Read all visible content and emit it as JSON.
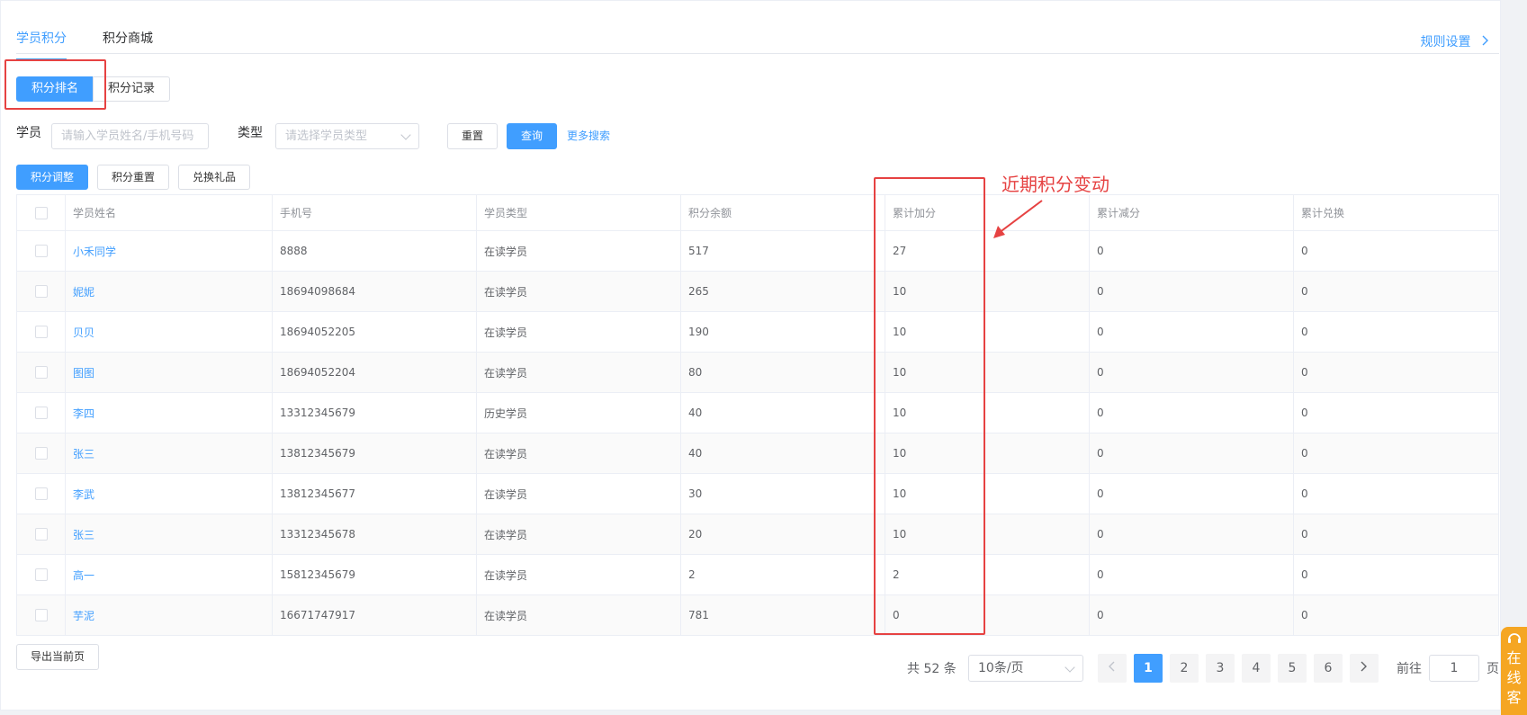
{
  "tabs": [
    {
      "label": "学员积分",
      "active": true
    },
    {
      "label": "积分商城",
      "active": false
    }
  ],
  "rule_link": "规则设置",
  "segments": [
    {
      "label": "积分排名",
      "active": true
    },
    {
      "label": "积分记录",
      "active": false
    }
  ],
  "search": {
    "student_label": "学员",
    "student_placeholder": "请输入学员姓名/手机号码",
    "type_label": "类型",
    "type_placeholder": "请选择学员类型",
    "reset_label": "重置",
    "query_label": "查询",
    "more_label": "更多搜索"
  },
  "actions": {
    "adjust_label": "积分调整",
    "reset_label": "积分重置",
    "redeem_label": "兑换礼品"
  },
  "table": {
    "columns": [
      "学员姓名",
      "手机号",
      "学员类型",
      "积分余额",
      "累计加分",
      "累计减分",
      "累计兑换"
    ],
    "rows": [
      {
        "name": "小禾同学",
        "phone": "8888",
        "type": "在读学员",
        "balance": "517",
        "added": "27",
        "deducted": "0",
        "redeemed": "0"
      },
      {
        "name": "妮妮",
        "phone": "18694098684",
        "type": "在读学员",
        "balance": "265",
        "added": "10",
        "deducted": "0",
        "redeemed": "0"
      },
      {
        "name": "贝贝",
        "phone": "18694052205",
        "type": "在读学员",
        "balance": "190",
        "added": "10",
        "deducted": "0",
        "redeemed": "0"
      },
      {
        "name": "图图",
        "phone": "18694052204",
        "type": "在读学员",
        "balance": "80",
        "added": "10",
        "deducted": "0",
        "redeemed": "0"
      },
      {
        "name": "李四",
        "phone": "13312345679",
        "type": "历史学员",
        "balance": "40",
        "added": "10",
        "deducted": "0",
        "redeemed": "0"
      },
      {
        "name": "张三",
        "phone": "13812345679",
        "type": "在读学员",
        "balance": "40",
        "added": "10",
        "deducted": "0",
        "redeemed": "0"
      },
      {
        "name": "李武",
        "phone": "13812345677",
        "type": "在读学员",
        "balance": "30",
        "added": "10",
        "deducted": "0",
        "redeemed": "0"
      },
      {
        "name": "张三",
        "phone": "13312345678",
        "type": "在读学员",
        "balance": "20",
        "added": "10",
        "deducted": "0",
        "redeemed": "0"
      },
      {
        "name": "高一",
        "phone": "15812345679",
        "type": "在读学员",
        "balance": "2",
        "added": "2",
        "deducted": "0",
        "redeemed": "0"
      },
      {
        "name": "芋泥",
        "phone": "16671747917",
        "type": "在读学员",
        "balance": "781",
        "added": "0",
        "deducted": "0",
        "redeemed": "0"
      }
    ]
  },
  "annotation": "近期积分变动",
  "export_label": "导出当前页",
  "pagination": {
    "total_text": "共 52 条",
    "page_size": "10条/页",
    "pages": [
      "1",
      "2",
      "3",
      "4",
      "5",
      "6"
    ],
    "current": "1",
    "goto_label": "前往",
    "goto_value": "1",
    "goto_suffix": "页"
  },
  "service_label": "在线客",
  "colors": {
    "primary": "#409eff",
    "annotation": "#e64242",
    "service": "#f5a623"
  }
}
